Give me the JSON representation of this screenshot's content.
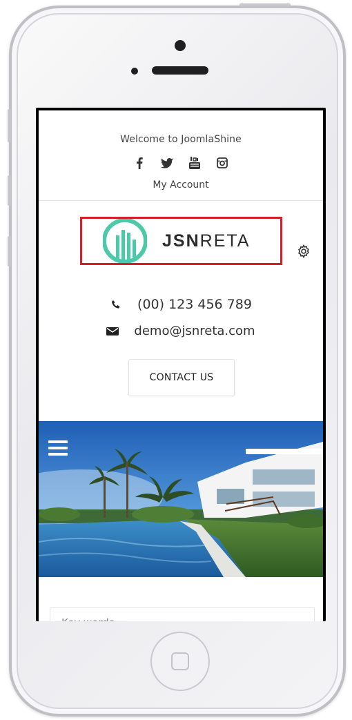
{
  "topbar": {
    "welcome_text": "Welcome to JoomlaShine",
    "social_icons": [
      "facebook-icon",
      "twitter-icon",
      "youtube-icon",
      "instagram-icon"
    ],
    "my_account_label": "My Account"
  },
  "logo": {
    "text_bold": "JSN",
    "text_light": "RETA",
    "mark_color": "#4cc9a8",
    "highlight_color": "#d61f2b"
  },
  "contact": {
    "phone": "(00) 123 456 789",
    "email": "demo@jsnreta.com",
    "button_label": "CONTACT US"
  },
  "search": {
    "placeholder": "Key words"
  }
}
